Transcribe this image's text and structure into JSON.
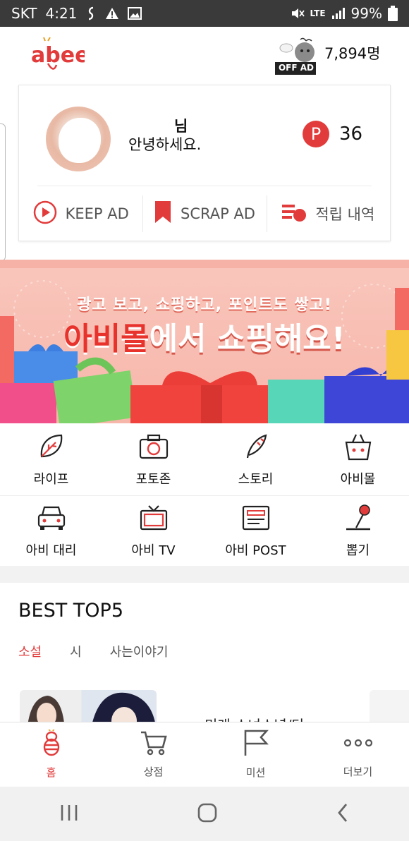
{
  "status_bar": {
    "carrier": "SKT",
    "time": "4:21",
    "network": "LTE",
    "battery": "99%",
    "icons": [
      "link-icon",
      "warning-icon",
      "image-icon",
      "mute-icon",
      "signal-icon",
      "battery-icon"
    ]
  },
  "header": {
    "logo_text": "abee",
    "offad_badge": "OFF AD",
    "member_count": "7,894명"
  },
  "profile": {
    "username": "님",
    "greeting": "안녕하세요.",
    "points_badge": "P",
    "points": "36"
  },
  "card_actions": [
    {
      "label": "KEEP AD",
      "icon": "play-circle-icon"
    },
    {
      "label": "SCRAP AD",
      "icon": "bookmark-icon"
    },
    {
      "label": "적립 내역",
      "icon": "history-list-icon"
    }
  ],
  "banner": {
    "line1": "광고 보고, 쇼핑하고, 포인트도 쌓고!",
    "line2_accent": "아비몰",
    "line2_rest": "에서 쇼핑해요!"
  },
  "menu": [
    [
      {
        "label": "라이프",
        "icon": "leaf-icon"
      },
      {
        "label": "포토존",
        "icon": "camera-icon"
      },
      {
        "label": "스토리",
        "icon": "feather-pen-icon"
      },
      {
        "label": "아비몰",
        "icon": "shopping-bag-icon"
      }
    ],
    [
      {
        "label": "아비 대리",
        "icon": "car-icon"
      },
      {
        "label": "아비 TV",
        "icon": "tv-icon"
      },
      {
        "label": "아비 POST",
        "icon": "post-icon"
      },
      {
        "label": "뽑기",
        "icon": "joystick-icon"
      }
    ]
  ],
  "best": {
    "title": "BEST TOP5",
    "tabs": [
      "소설",
      "시",
      "사는이야기"
    ],
    "active_tab": "소설",
    "story_title": "미래 소녀소년/단..."
  },
  "bottom_nav": [
    {
      "label": "홈",
      "icon": "home-bee-icon",
      "active": true
    },
    {
      "label": "상점",
      "icon": "cart-icon",
      "active": false
    },
    {
      "label": "미션",
      "icon": "flag-icon",
      "active": false
    },
    {
      "label": "더보기",
      "icon": "more-icon",
      "active": false
    }
  ],
  "colors": {
    "accent": "#e23b3b",
    "banner_bg": "#f8bdb1",
    "status_bar": "#3a3a3a"
  }
}
